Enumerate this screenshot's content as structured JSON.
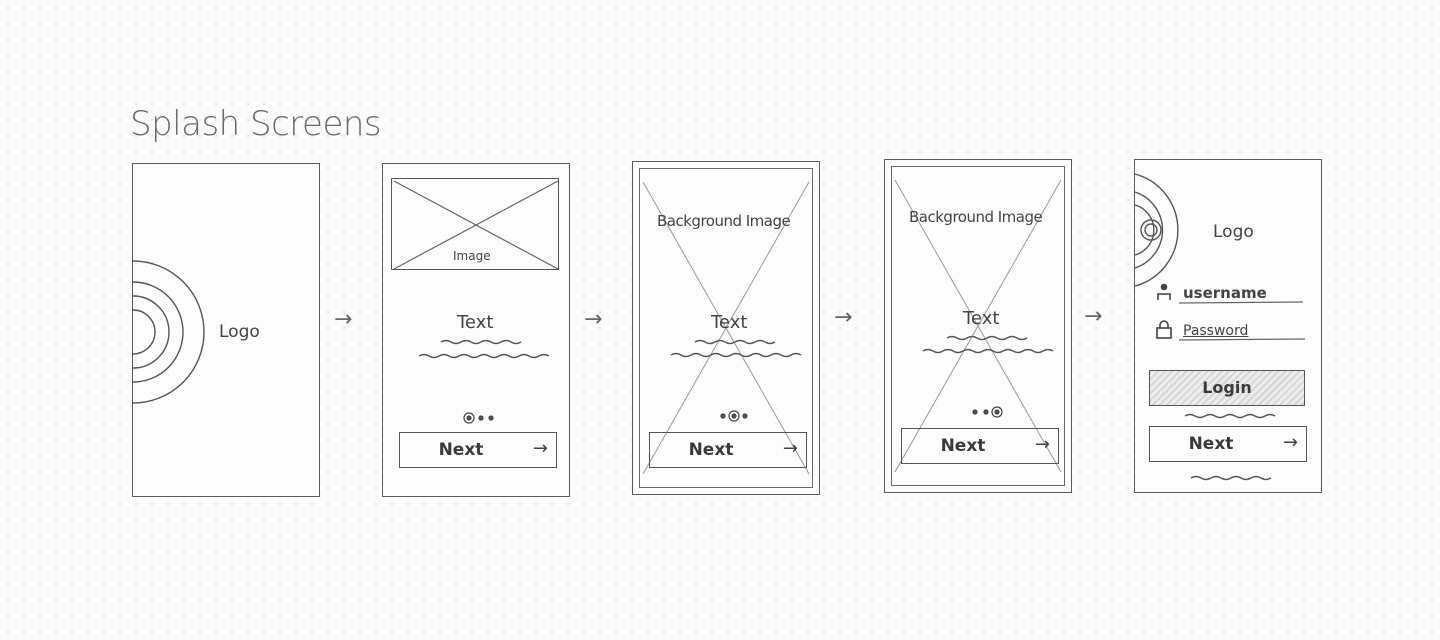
{
  "page": {
    "title": "Splash Screens"
  },
  "screens": [
    {
      "logo_label": "Logo"
    },
    {
      "image_label": "Image",
      "text_label": "Text",
      "next_label": "Next",
      "arrow_glyph": "→"
    },
    {
      "bg_label": "Background Image",
      "text_label": "Text",
      "next_label": "Next",
      "arrow_glyph": "→"
    },
    {
      "bg_label": "Background Image",
      "text_label": "Text",
      "next_label": "Next",
      "arrow_glyph": "→"
    },
    {
      "logo_label": "Logo",
      "username_label": "username",
      "password_label": "Password",
      "login_label": "Login",
      "next_label": "Next",
      "arrow_glyph": "→"
    }
  ],
  "flow": {
    "arrow_glyph": "→"
  },
  "icons": [
    "logo-rings-icon",
    "image-placeholder-icon",
    "pagination-dots-icon",
    "user-icon",
    "lock-icon",
    "arrow-right-icon"
  ]
}
